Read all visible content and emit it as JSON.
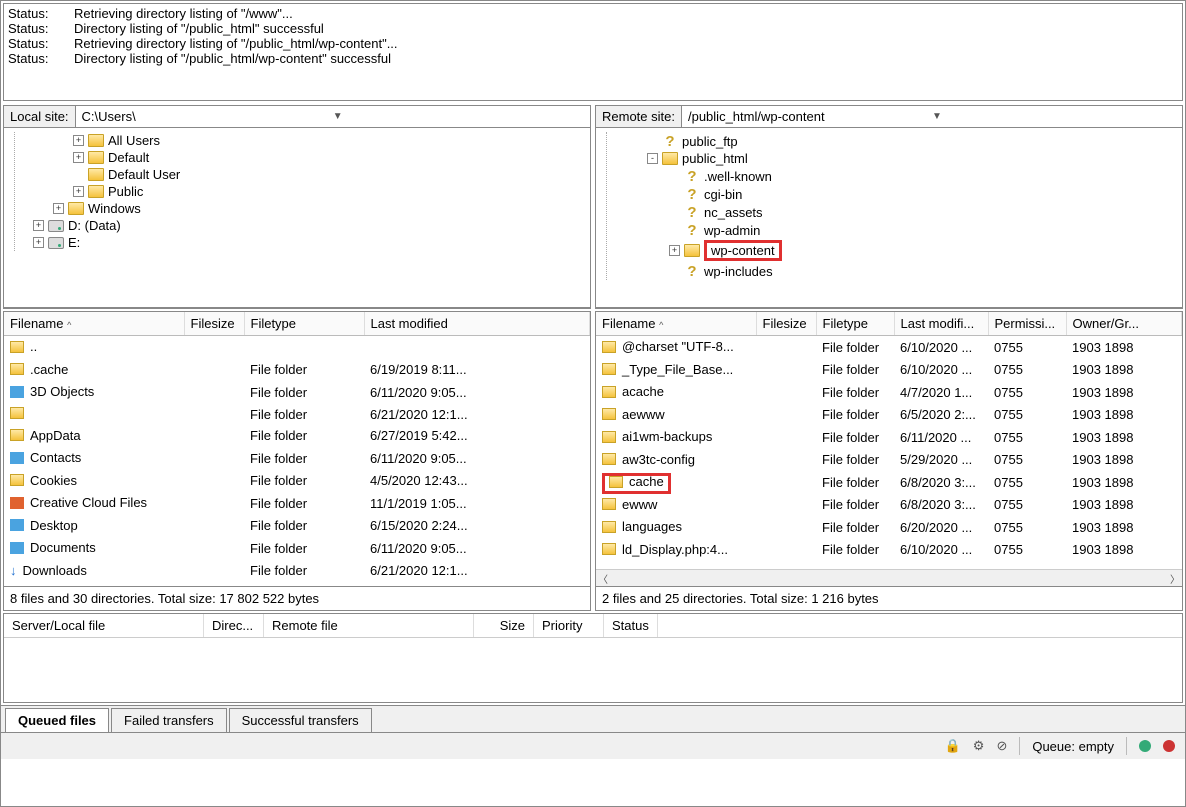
{
  "log": [
    {
      "label": "Status:",
      "text": "Retrieving directory listing of \"/www\"..."
    },
    {
      "label": "Status:",
      "text": "Directory listing of \"/public_html\" successful"
    },
    {
      "label": "Status:",
      "text": "Retrieving directory listing of \"/public_html/wp-content\"..."
    },
    {
      "label": "Status:",
      "text": "Directory listing of \"/public_html/wp-content\" successful"
    }
  ],
  "local": {
    "label": "Local site:",
    "path": "C:\\Users\\",
    "cols": [
      "Filename",
      "Filesize",
      "Filetype",
      "Last modified"
    ],
    "rows": [
      {
        "icon": "folder",
        "name": "..",
        "type": "",
        "mod": ""
      },
      {
        "icon": "folder",
        "name": ".cache",
        "type": "File folder",
        "mod": "6/19/2019 8:11..."
      },
      {
        "icon": "blue",
        "name": "3D Objects",
        "type": "File folder",
        "mod": "6/11/2020 9:05..."
      },
      {
        "icon": "folder",
        "name": "",
        "type": "File folder",
        "mod": "6/21/2020 12:1..."
      },
      {
        "icon": "folder",
        "name": "AppData",
        "type": "File folder",
        "mod": "6/27/2019 5:42..."
      },
      {
        "icon": "blue",
        "name": "Contacts",
        "type": "File folder",
        "mod": "6/11/2020 9:05..."
      },
      {
        "icon": "folder",
        "name": "Cookies",
        "type": "File folder",
        "mod": "4/5/2020 12:43..."
      },
      {
        "icon": "orange",
        "name": "Creative Cloud Files",
        "type": "File folder",
        "mod": "11/1/2019 1:05..."
      },
      {
        "icon": "blue",
        "name": "Desktop",
        "type": "File folder",
        "mod": "6/15/2020 2:24..."
      },
      {
        "icon": "blue",
        "name": "Documents",
        "type": "File folder",
        "mod": "6/11/2020 9:05..."
      },
      {
        "icon": "dl",
        "name": "Downloads",
        "type": "File folder",
        "mod": "6/21/2020 12:1..."
      }
    ],
    "status": "8 files and 30 directories. Total size: 17 802 522 bytes"
  },
  "local_tree": [
    {
      "exp": "+",
      "icon": "folder",
      "label": "All Users"
    },
    {
      "exp": "+",
      "icon": "folder",
      "label": "Default"
    },
    {
      "exp": "",
      "icon": "folder",
      "label": "Default User"
    },
    {
      "exp": "+",
      "icon": "folder",
      "label": "Public"
    },
    {
      "exp": "+",
      "icon": "folder",
      "label": "Windows",
      "outdent": 1
    },
    {
      "exp": "+",
      "icon": "drive",
      "label": "D: (Data)",
      "outdent": 2
    },
    {
      "exp": "+",
      "icon": "drive",
      "label": "E:",
      "outdent": 2
    }
  ],
  "remote": {
    "label": "Remote site:",
    "path": "/public_html/wp-content",
    "cols": [
      "Filename",
      "Filesize",
      "Filetype",
      "Last modifi...",
      "Permissi...",
      "Owner/Gr..."
    ],
    "rows": [
      {
        "name": "@charset \"UTF-8...",
        "type": "File folder",
        "mod": "6/10/2020 ...",
        "perm": "0755",
        "own": "1903 1898"
      },
      {
        "name": "_Type_File_Base...",
        "type": "File folder",
        "mod": "6/10/2020 ...",
        "perm": "0755",
        "own": "1903 1898"
      },
      {
        "name": "acache",
        "type": "File folder",
        "mod": "4/7/2020 1...",
        "perm": "0755",
        "own": "1903 1898"
      },
      {
        "name": "aewww",
        "type": "File folder",
        "mod": "6/5/2020 2:...",
        "perm": "0755",
        "own": "1903 1898"
      },
      {
        "name": "ai1wm-backups",
        "type": "File folder",
        "mod": "6/11/2020 ...",
        "perm": "0755",
        "own": "1903 1898"
      },
      {
        "name": "aw3tc-config",
        "type": "File folder",
        "mod": "5/29/2020 ...",
        "perm": "0755",
        "own": "1903 1898"
      },
      {
        "name": "cache",
        "type": "File folder",
        "mod": "6/8/2020 3:...",
        "perm": "0755",
        "own": "1903 1898",
        "hl": true
      },
      {
        "name": "ewww",
        "type": "File folder",
        "mod": "6/8/2020 3:...",
        "perm": "0755",
        "own": "1903 1898"
      },
      {
        "name": "languages",
        "type": "File folder",
        "mod": "6/20/2020 ...",
        "perm": "0755",
        "own": "1903 1898"
      },
      {
        "name": "ld_Display.php:4...",
        "type": "File folder",
        "mod": "6/10/2020 ...",
        "perm": "0755",
        "own": "1903 1898"
      }
    ],
    "status": "2 files and 25 directories. Total size: 1 216 bytes"
  },
  "remote_tree": [
    {
      "exp": "",
      "icon": "q",
      "label": "public_ftp",
      "indent": 1
    },
    {
      "exp": "-",
      "icon": "folder",
      "label": "public_html",
      "indent": 1
    },
    {
      "exp": "",
      "icon": "q",
      "label": ".well-known",
      "indent": 2
    },
    {
      "exp": "",
      "icon": "q",
      "label": "cgi-bin",
      "indent": 2
    },
    {
      "exp": "",
      "icon": "q",
      "label": "nc_assets",
      "indent": 2
    },
    {
      "exp": "",
      "icon": "q",
      "label": "wp-admin",
      "indent": 2
    },
    {
      "exp": "+",
      "icon": "folder",
      "label": "wp-content",
      "indent": 2,
      "hl": true
    },
    {
      "exp": "",
      "icon": "q",
      "label": "wp-includes",
      "indent": 2
    }
  ],
  "queue_cols": [
    "Server/Local file",
    "Direc...",
    "Remote file",
    "Size",
    "Priority",
    "Status"
  ],
  "tabs": [
    "Queued files",
    "Failed transfers",
    "Successful transfers"
  ],
  "bottom": {
    "queue_label": "Queue: empty"
  }
}
